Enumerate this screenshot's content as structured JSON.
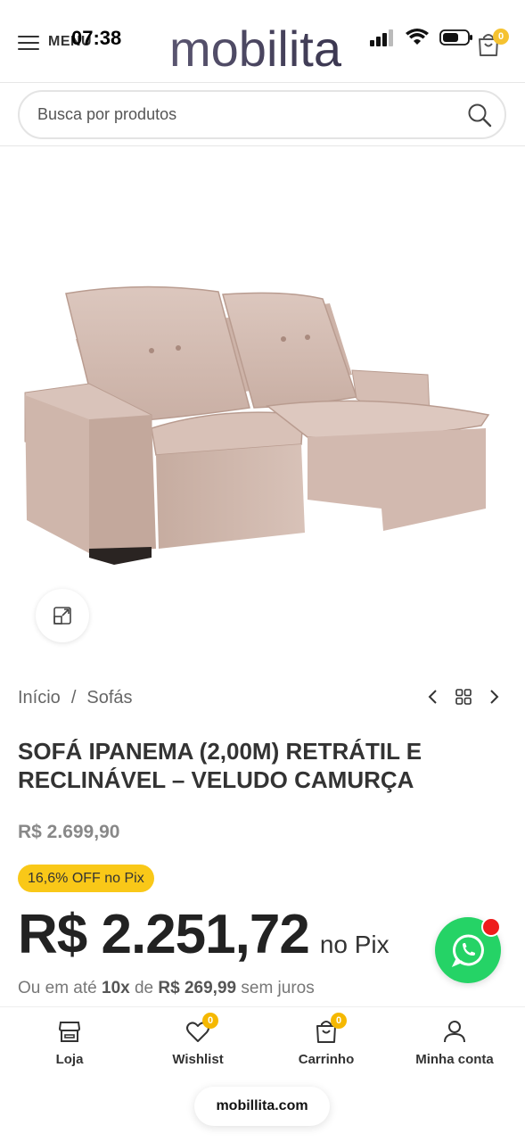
{
  "status_bar": {
    "time": "07:38"
  },
  "header": {
    "menu_label": "MENU",
    "logo_text": "mobilita",
    "cart_count": "0"
  },
  "search": {
    "placeholder": "Busca por produtos"
  },
  "breadcrumb": {
    "home": "Início",
    "separator": "/",
    "category": "Sofás"
  },
  "product": {
    "title": "SOFÁ IPANEMA (2,00M) RETRÁTIL E RECLINÁVEL – VELUDO CAMURÇA",
    "old_price": "R$ 2.699,90",
    "discount_badge": "16,6% OFF no Pix",
    "price": "R$ 2.251,72",
    "price_suffix": "no Pix",
    "installments_prefix": "Ou em até",
    "installments_count": "10x",
    "installments_mid": "de",
    "installments_value": "R$ 269,99",
    "installments_suffix": "sem juros"
  },
  "bottom_nav": {
    "items": [
      {
        "label": "Loja",
        "icon": "store-icon"
      },
      {
        "label": "Wishlist",
        "icon": "heart-icon",
        "badge": "0"
      },
      {
        "label": "Carrinho",
        "icon": "cart-icon",
        "badge": "0"
      },
      {
        "label": "Minha conta",
        "icon": "user-icon"
      }
    ]
  },
  "browser": {
    "url": "mobillita.com"
  },
  "colors": {
    "badge_yellow": "#f5b800",
    "discount_yellow": "#f9c818",
    "whatsapp_green": "#25d366",
    "notification_red": "#ee1c1c",
    "sofa": "#d9c3ba"
  }
}
